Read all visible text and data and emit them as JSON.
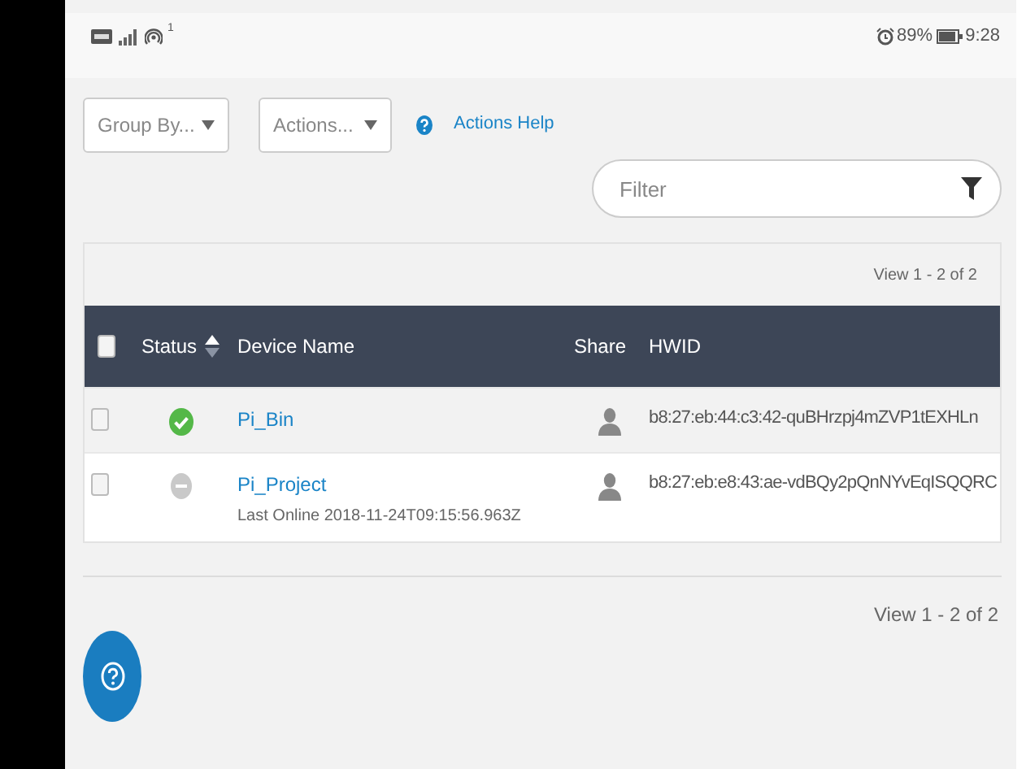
{
  "status_bar": {
    "hotspot_count": "1",
    "battery": "89%",
    "time": "9:28"
  },
  "toolbar": {
    "group_by": {
      "placeholder": "Group By..."
    },
    "actions": {
      "placeholder": "Actions..."
    },
    "help_link": "Actions Help"
  },
  "filter": {
    "placeholder": "Filter"
  },
  "table": {
    "pager_top": "View 1 - 2 of 2",
    "select_all_checked": false,
    "columns": [
      "Status",
      "Device Name",
      "Share",
      "HWID"
    ],
    "rows": [
      {
        "checked": false,
        "highlighted": true,
        "kind": "online",
        "name": "Pi_Bin",
        "hwid": "b8:27:eb:44:c3:42-quBHrzpj4mZVP1tEXHLn"
      },
      {
        "checked": false,
        "highlighted": false,
        "kind": "offline",
        "name": "Pi_Project",
        "last_online": "Last Online 2018-11-24T09:15:56.963Z",
        "hwid": "b8:27:eb:e8:43:ae-vdBQy2pQnNYvEqISQQRC"
      }
    ]
  },
  "pager_bottom": "View 1 - 2 of 2"
}
